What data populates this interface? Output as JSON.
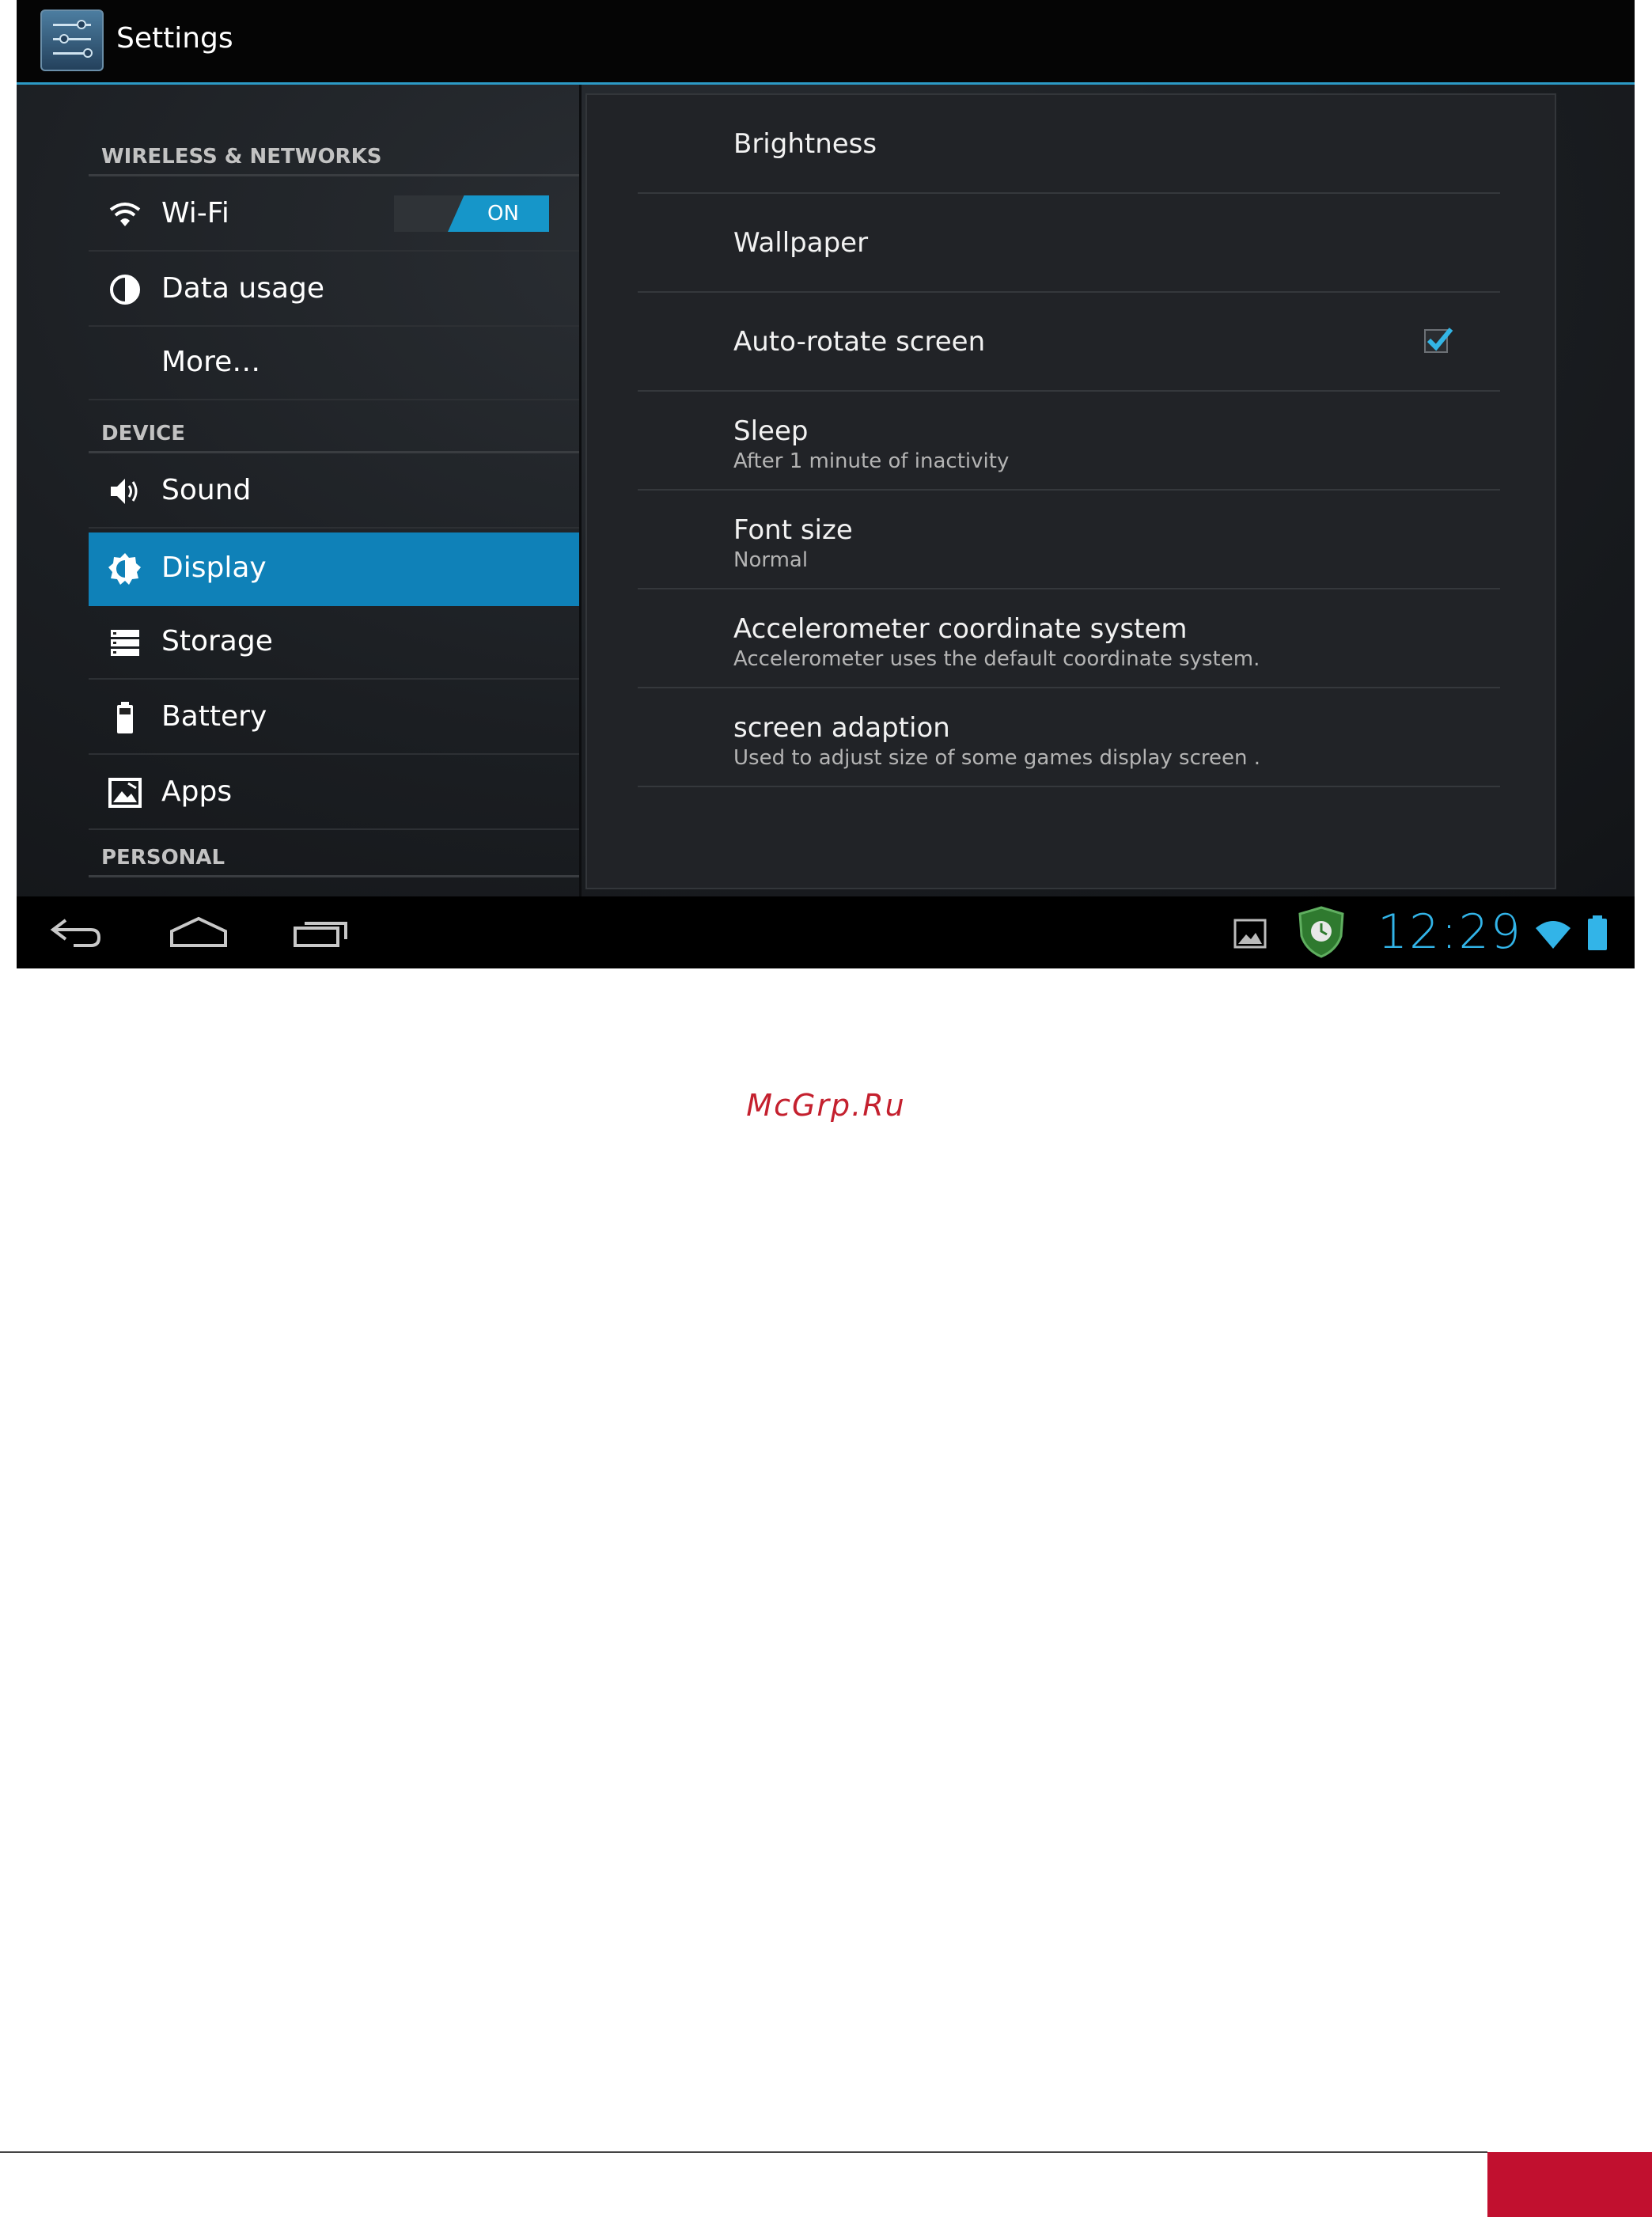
{
  "actionbar": {
    "title": "Settings",
    "icon": "settings-sliders-icon"
  },
  "left_panel": {
    "sections": [
      {
        "header": "WIRELESS & NETWORKS"
      },
      {
        "header": "DEVICE"
      },
      {
        "header": "PERSONAL"
      }
    ],
    "items": [
      {
        "label": "Wi-Fi",
        "icon": "wifi-icon",
        "toggle": "ON"
      },
      {
        "label": "Data usage",
        "icon": "data-usage-icon"
      },
      {
        "label": "More…"
      },
      {
        "label": "Sound",
        "icon": "speaker-icon"
      },
      {
        "label": "Display",
        "icon": "brightness-icon",
        "selected": true
      },
      {
        "label": "Storage",
        "icon": "storage-icon"
      },
      {
        "label": "Battery",
        "icon": "battery-icon"
      },
      {
        "label": "Apps",
        "icon": "apps-icon"
      }
    ]
  },
  "display_settings": [
    {
      "title": "Brightness"
    },
    {
      "title": "Wallpaper"
    },
    {
      "title": "Auto-rotate screen",
      "checked": true
    },
    {
      "title": "Sleep",
      "summary": "After 1 minute of inactivity"
    },
    {
      "title": "Font size",
      "summary": "Normal"
    },
    {
      "title": "Accelerometer coordinate system",
      "summary": "Accelerometer uses the default coordinate system."
    },
    {
      "title": "screen adaption",
      "summary": "Used to adjust size of some games display screen ."
    }
  ],
  "navbar": {
    "buttons": [
      "back-icon",
      "home-icon",
      "recent-apps-icon"
    ],
    "status_icons": [
      "gallery-notification-icon",
      "shield-notification-icon",
      "wifi-status-icon",
      "battery-status-icon"
    ],
    "clock": "12:29"
  },
  "page": {
    "watermark": "McGrp.Ru"
  },
  "colors": {
    "accent": "#0f81b8",
    "clock": "#32b4e8",
    "footer": "#c1102f"
  }
}
